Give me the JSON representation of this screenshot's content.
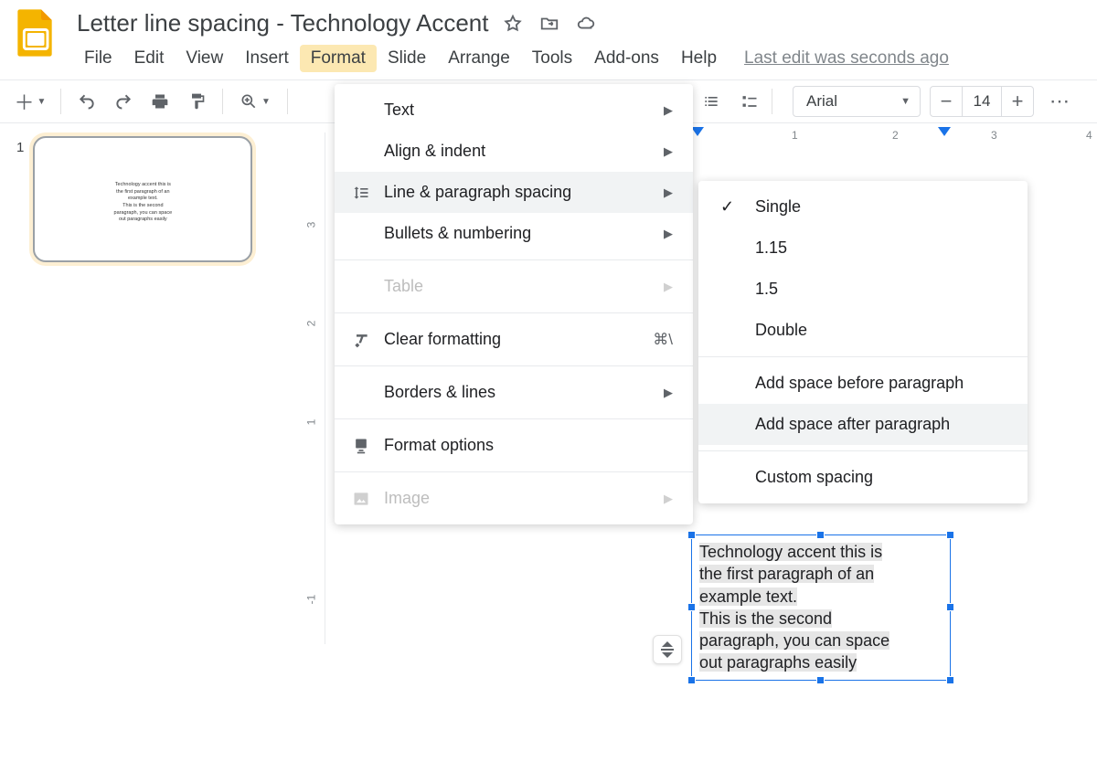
{
  "doc": {
    "title": "Letter line spacing - Technology Accent",
    "last_edit": "Last edit was seconds ago"
  },
  "menubar": [
    "File",
    "Edit",
    "View",
    "Insert",
    "Format",
    "Slide",
    "Arrange",
    "Tools",
    "Add-ons",
    "Help"
  ],
  "menubar_active_index": 4,
  "toolbar": {
    "font_name": "Arial",
    "font_size": "14"
  },
  "format_menu": {
    "text": "Text",
    "align": "Align & indent",
    "line": "Line & paragraph spacing",
    "bullets": "Bullets & numbering",
    "table": "Table",
    "clear": "Clear formatting",
    "clear_shortcut": "⌘\\",
    "borders": "Borders & lines",
    "options": "Format options",
    "image": "Image"
  },
  "line_submenu": {
    "single": "Single",
    "v115": "1.15",
    "v15": "1.5",
    "double": "Double",
    "before": "Add space before paragraph",
    "after": "Add space after paragraph",
    "custom": "Custom spacing"
  },
  "thumb": {
    "number": "1",
    "line1": "Technology accent this is",
    "line2": "the first paragraph of an",
    "line3": "example text.",
    "line4": "This is the second",
    "line5": "paragraph, you can space",
    "line6": "out paragraphs easily"
  },
  "ruler": {
    "n1": "1",
    "n2": "2",
    "n3": "3",
    "n4": "4"
  },
  "vruler": {
    "n3": "3",
    "n2": "2",
    "n1": "1",
    "nm1": "-1"
  },
  "textbox": {
    "l1": "Technology accent this is",
    "l2": "the first paragraph of an",
    "l3": "example text.",
    "l4": "This is the second",
    "l5": "paragraph, you can space",
    "l6": "out paragraphs easily"
  }
}
